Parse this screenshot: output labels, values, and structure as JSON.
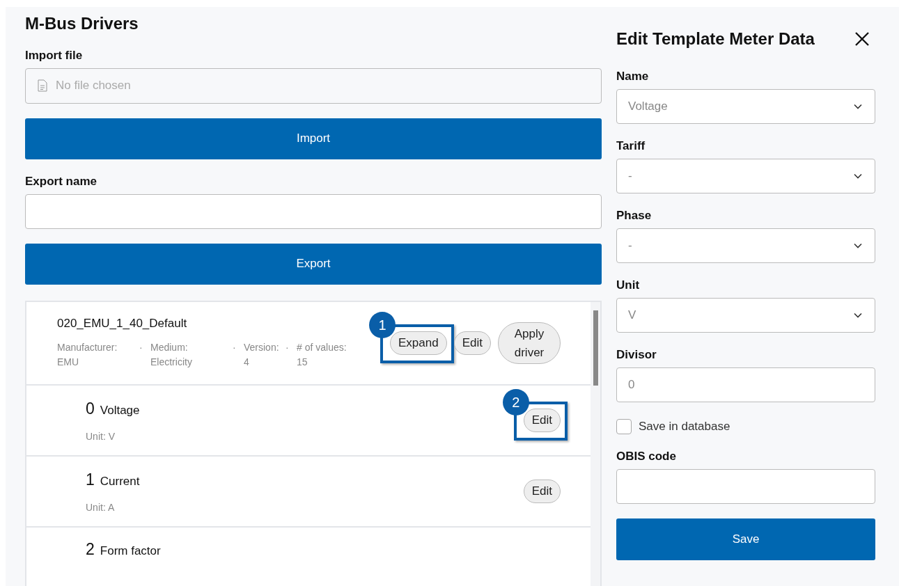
{
  "page": {
    "title": "M-Bus Drivers"
  },
  "import": {
    "label": "Import file",
    "placeholder": "No file chosen",
    "button": "Import"
  },
  "export": {
    "label": "Export name",
    "button": "Export"
  },
  "driver": {
    "name": "020_EMU_1_40_Default",
    "meta": [
      {
        "label": "Manufacturer:",
        "value": "EMU"
      },
      {
        "separator": "·",
        "label": "Medium:",
        "value": "Electricity"
      },
      {
        "separator": "·",
        "label": "Version:",
        "value": "4"
      },
      {
        "separator": "·",
        "label": "# of values:",
        "value": "15"
      }
    ],
    "buttons": [
      {
        "label": "Expand",
        "callout": "1"
      },
      {
        "label": "Edit"
      },
      {
        "label": "Apply driver"
      }
    ]
  },
  "values": [
    {
      "index": "0",
      "name": "Voltage",
      "unit": "Unit: V",
      "button": "Edit",
      "callout": "2"
    },
    {
      "index": "1",
      "name": "Current",
      "unit": "Unit: A",
      "button": "Edit"
    },
    {
      "index": "2",
      "name": "Form factor"
    }
  ],
  "panel": {
    "title": "Edit Template Meter Data",
    "fields": [
      {
        "kind": "select",
        "label": "Name",
        "value": "Voltage"
      },
      {
        "kind": "select",
        "label": "Tariff",
        "value": "-"
      },
      {
        "kind": "select",
        "label": "Phase",
        "value": "-"
      },
      {
        "kind": "select",
        "label": "Unit",
        "value": "V"
      },
      {
        "kind": "input",
        "label": "Divisor",
        "placeholder": "0"
      },
      {
        "kind": "checkbox",
        "label": "Save in database",
        "checked": false
      },
      {
        "kind": "input",
        "label": "OBIS code"
      }
    ],
    "button": "Save"
  }
}
